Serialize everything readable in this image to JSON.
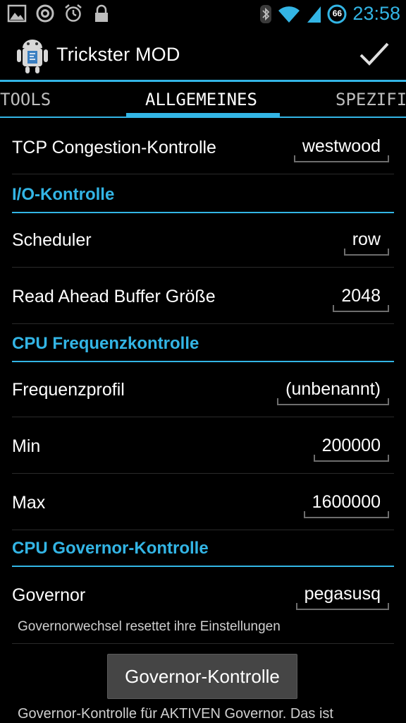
{
  "status_bar": {
    "icons_left": [
      "image-icon",
      "circle-a-icon",
      "alarm-icon",
      "lock-icon"
    ],
    "icons_right": [
      "bluetooth-icon",
      "wifi-icon",
      "signal-icon",
      "battery-icon"
    ],
    "battery_level": "66",
    "time": "23:58"
  },
  "action_bar": {
    "title": "Trickster MOD",
    "done_icon": "checkmark-icon"
  },
  "tabs": {
    "left": "TOOLS",
    "center": "ALLGEMEINES",
    "right": "SPEZIFI"
  },
  "rows": {
    "tcp": {
      "label": "TCP Congestion-Kontrolle",
      "value": "westwood"
    },
    "scheduler": {
      "label": "Scheduler",
      "value": "row"
    },
    "readahead": {
      "label": "Read Ahead Buffer Größe",
      "value": "2048"
    },
    "freqprofile": {
      "label": "Frequenzprofil",
      "value": "(unbenannt)"
    },
    "min": {
      "label": "Min",
      "value": "200000"
    },
    "max": {
      "label": "Max",
      "value": "1600000"
    },
    "governor": {
      "label": "Governor",
      "value": "pegasusq"
    }
  },
  "sections": {
    "io": "I/O-Kontrolle",
    "cpu_freq": "CPU Frequenzkontrolle",
    "cpu_gov": "CPU Governor-Kontrolle"
  },
  "governor_note": "Governorwechsel resettet ihre Einstellungen",
  "governor_button": "Governor-Kontrolle",
  "bottom_note": "Governor-Kontrolle für AKTIVEN Governor. Das ist",
  "colors": {
    "accent": "#33b5e5",
    "background": "#000000"
  }
}
